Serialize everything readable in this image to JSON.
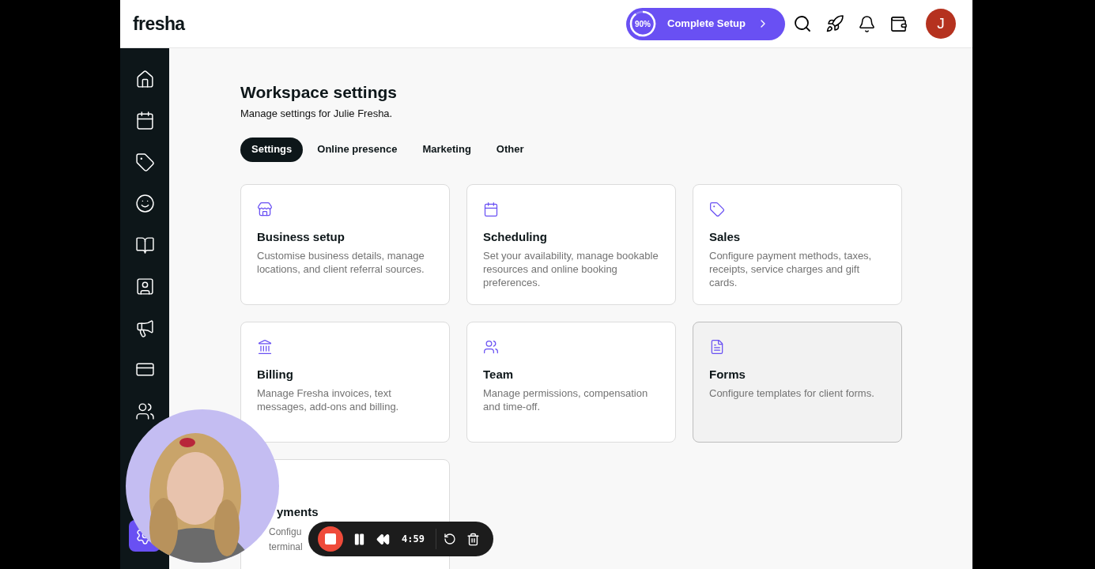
{
  "logo": "fresha",
  "setup": {
    "percent": "90%",
    "level": 0.9,
    "label": "Complete Setup"
  },
  "avatar": {
    "initial": "J"
  },
  "sidebar": {
    "items": [
      {
        "selected": false
      },
      {
        "selected": false
      },
      {
        "selected": false
      },
      {
        "selected": false
      },
      {
        "selected": false
      },
      {
        "selected": false
      },
      {
        "selected": false
      },
      {
        "selected": false
      },
      {
        "selected": false
      },
      {
        "selected": true
      }
    ]
  },
  "page": {
    "title": "Workspace settings",
    "subtitle": "Manage settings for Julie Fresha."
  },
  "tabs": [
    {
      "label": "Settings",
      "selected": true
    },
    {
      "label": "Online presence",
      "selected": false
    },
    {
      "label": "Marketing",
      "selected": false
    },
    {
      "label": "Other",
      "selected": false
    }
  ],
  "cards": [
    {
      "title": "Business setup",
      "description": "Customise business details, manage locations, and client referral sources.",
      "hovered": false
    },
    {
      "title": "Scheduling",
      "description": "Set your availability, manage bookable resources and online booking preferences.",
      "hovered": false
    },
    {
      "title": "Sales",
      "description": "Configure payment methods, taxes, receipts, service charges and gift cards.",
      "hovered": false
    },
    {
      "title": "Billing",
      "description": "Manage Fresha invoices, text messages, add-ons and billing.",
      "hovered": false
    },
    {
      "title": "Team",
      "description": "Manage permissions, compensation and time-off.",
      "hovered": false
    },
    {
      "title": "Forms",
      "description": "Configure templates for client forms.",
      "hovered": true
    }
  ],
  "partial_card": {
    "title": "yments",
    "line_1": "Configu",
    "line_2": "terminal"
  },
  "recorder": {
    "time": "4:59"
  }
}
